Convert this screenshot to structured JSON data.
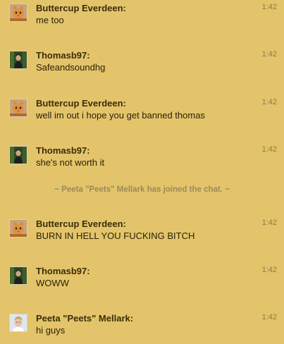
{
  "messages": [
    {
      "user": "Buttercup Everdeen:",
      "text": "me too",
      "time": "1:42",
      "avatar": "cat-avatar-icon"
    },
    {
      "user": "Thomasb97:",
      "text": "Safeandsoundhg",
      "time": "1:42",
      "avatar": "person-avatar-icon"
    },
    {
      "user": "Buttercup Everdeen:",
      "text": "well im out i hope you get banned thomas",
      "time": "1:42",
      "avatar": "cat-avatar-icon"
    },
    {
      "user": "Thomasb97:",
      "text": "she's not worth it",
      "time": "1:42",
      "avatar": "person-avatar-icon"
    },
    {
      "user": "Buttercup Everdeen:",
      "text": "BURN IN HELL YOU FUCKING BITCH",
      "time": "1:42",
      "avatar": "cat-avatar-icon"
    },
    {
      "user": "Thomasb97:",
      "text": "WOWW",
      "time": "1:42",
      "avatar": "person-avatar-icon"
    },
    {
      "user": "Peeta \"Peets\" Mellark:",
      "text": "hi guys",
      "time": "1:42",
      "avatar": "boy-avatar-icon"
    }
  ],
  "system_message": "~ Peeta \"Peets\" Mellark has joined the chat. ~",
  "colors": {
    "background": "#e3c46a",
    "username": "#3a2d0a",
    "timestamp": "#8b7a4a",
    "system": "#9a8a5a"
  }
}
